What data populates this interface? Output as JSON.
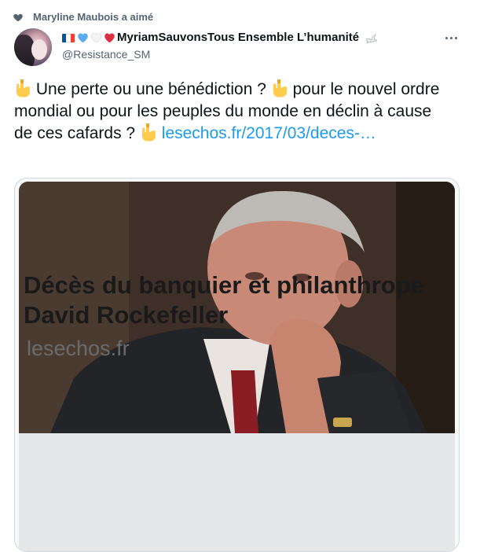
{
  "social_context": {
    "icon": "heart-icon",
    "text": "Maryline Maubois a aimé"
  },
  "author": {
    "name": "MyriamSauvonsTous Ensemble L’humanité",
    "handle": "@Resistance_SM",
    "name_prefix_icons": [
      "france-flag-icon",
      "blue-heart-icon",
      "white-heart-icon",
      "red-heart-icon"
    ],
    "name_suffix_icon": "dove-icon"
  },
  "tweet": {
    "part1": "Une perte ou une bénédiction ?",
    "part2": "pour le nouvel ordre mondial ou pour les peuples du monde en déclin à cause de ces cafards ?",
    "link": "lesechos.fr/2017/03/deces-…",
    "emoji_icon": "pointing-down-icon"
  },
  "card": {
    "image_alt": "photo-of-elderly-man-hand-on-chin",
    "title": "Décès du banquier et philanthrope David Rockefeller",
    "domain": "lesechos.fr"
  },
  "colors": {
    "link": "#1d9bf0",
    "secondary_text": "#536471",
    "card_footer_bg": "#e6e7e8"
  }
}
